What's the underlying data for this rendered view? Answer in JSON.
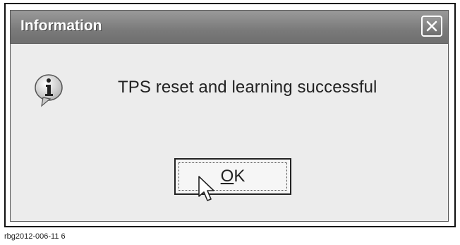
{
  "dialog": {
    "title": "Information",
    "message": "TPS reset and learning successful",
    "ok_mnemonic": "O",
    "ok_rest": "K",
    "icons": {
      "info": "info-icon",
      "close": "close-icon",
      "cursor": "mouse-pointer-icon"
    }
  },
  "caption": "rbg2012-006-11 6"
}
